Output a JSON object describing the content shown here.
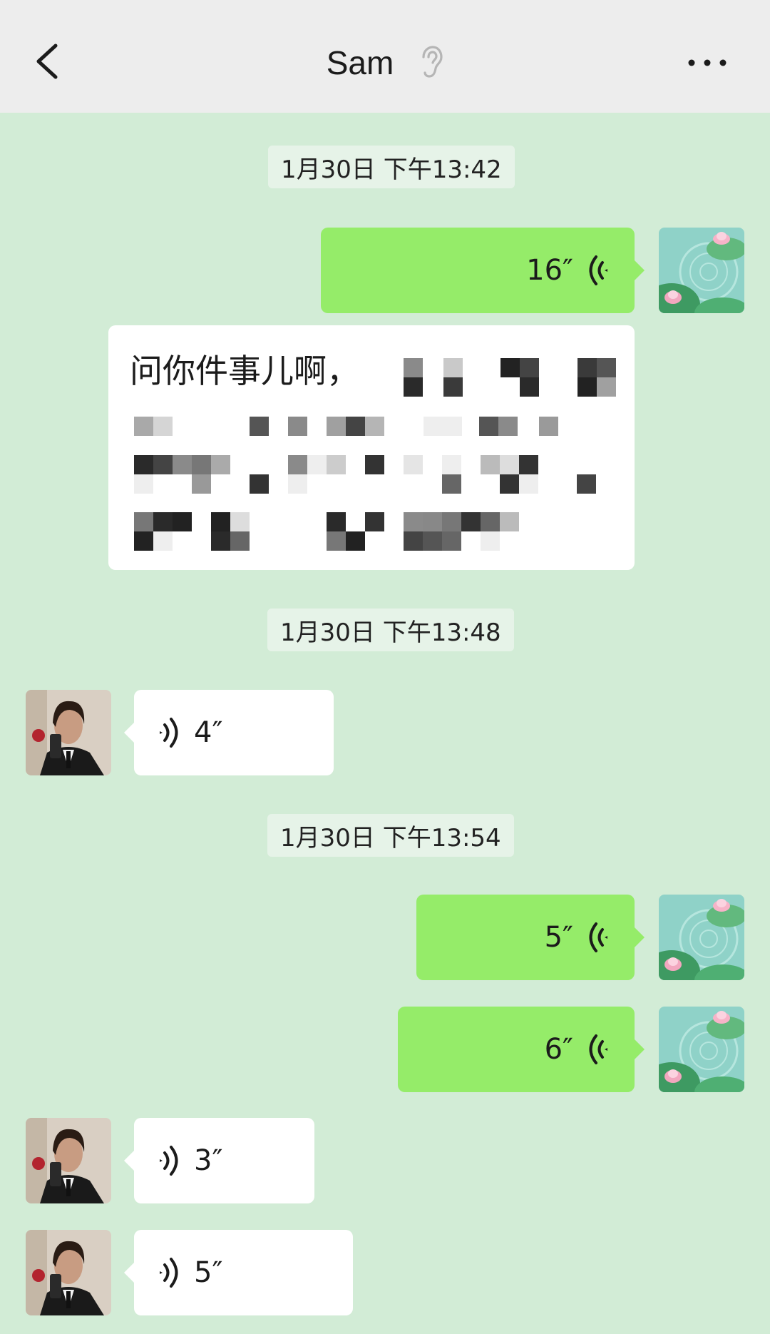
{
  "header": {
    "title": "Sam"
  },
  "icons": {
    "back": "chevron-left-icon",
    "listening": "ear-icon",
    "more": "more-dots-icon",
    "voice": "voice-wave-icon"
  },
  "colors": {
    "chat_background": "#d2ecd6",
    "header_background": "#ededed",
    "sent_bubble": "#95ec69",
    "received_bubble": "#ffffff"
  },
  "messages": [
    {
      "type": "timestamp",
      "text": "1月30日 下午13:42"
    },
    {
      "type": "voice",
      "direction": "sent",
      "duration": "16″"
    },
    {
      "type": "text",
      "direction": "sent",
      "text": "问你件事儿啊，",
      "pixelated": true
    },
    {
      "type": "timestamp",
      "text": "1月30日 下午13:48"
    },
    {
      "type": "voice",
      "direction": "received",
      "duration": "4″"
    },
    {
      "type": "timestamp",
      "text": "1月30日 下午13:54"
    },
    {
      "type": "voice",
      "direction": "sent",
      "duration": "5″"
    },
    {
      "type": "voice",
      "direction": "sent",
      "duration": "6″"
    },
    {
      "type": "voice",
      "direction": "received",
      "duration": "3″"
    },
    {
      "type": "voice",
      "direction": "received",
      "duration": "5″"
    }
  ]
}
